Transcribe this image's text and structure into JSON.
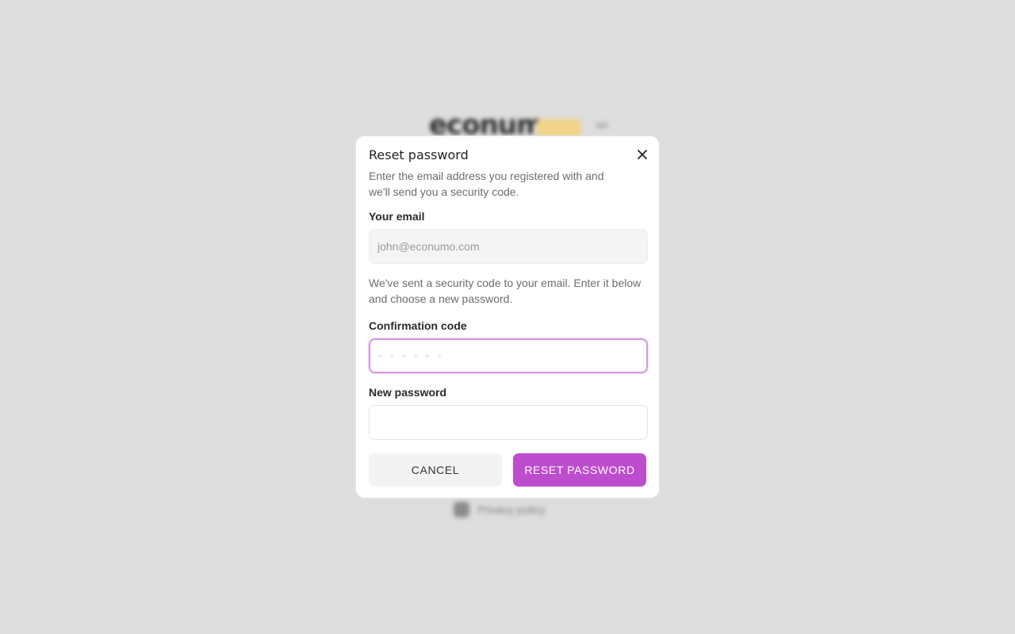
{
  "background": {
    "logo_text": "econum",
    "lang_text": "en",
    "footer_text": "Privacy policy"
  },
  "dialog": {
    "title": "Reset password",
    "description": "Enter the email address you registered with and we'll send you a security code.",
    "email_label": "Your email",
    "email_placeholder": "john@econumo.com",
    "code_sent_text": "We've sent a security code to your email. Enter it below and choose a new password.",
    "code_label": "Confirmation code",
    "code_placeholder": "••••••",
    "password_label": "New password",
    "cancel_label": "CANCEL",
    "reset_label": "RESET PASSWORD",
    "close_icon": "close-icon"
  },
  "colors": {
    "accent": "#be4ccf",
    "focus_ring": "#d49be0",
    "backdrop": "#dedede"
  }
}
